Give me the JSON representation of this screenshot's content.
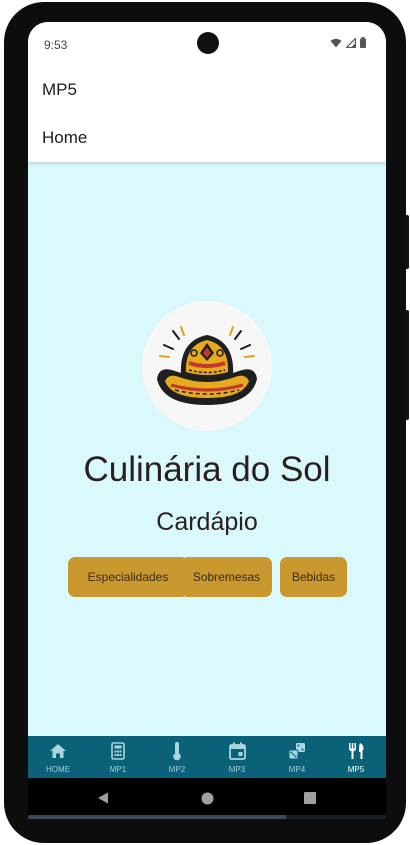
{
  "status": {
    "time": "9:53"
  },
  "appbar": {
    "title": "MP5"
  },
  "subbar": {
    "title": "Home"
  },
  "main": {
    "logo_icon": "sombrero-logo-icon",
    "title": "Culinária do Sol",
    "subtitle": "Cardápio",
    "buttons": [
      {
        "label": "Especialidades"
      },
      {
        "label": "Sobremesas"
      },
      {
        "label": "Bebidas"
      }
    ]
  },
  "bottom_nav": {
    "items": [
      {
        "label": "HOME",
        "icon": "home-icon"
      },
      {
        "label": "MP1",
        "icon": "calculator-icon"
      },
      {
        "label": "MP2",
        "icon": "thermometer-icon"
      },
      {
        "label": "MP3",
        "icon": "calendar-icon"
      },
      {
        "label": "MP4",
        "icon": "dice-icon"
      },
      {
        "label": "MP5",
        "icon": "restaurant-icon"
      }
    ],
    "active": "MP5"
  },
  "colors": {
    "content_bg": "#daf9fc",
    "button_bg": "#c9982e",
    "nav_bg": "#0b6278",
    "title_text": "#2a1f1f"
  }
}
